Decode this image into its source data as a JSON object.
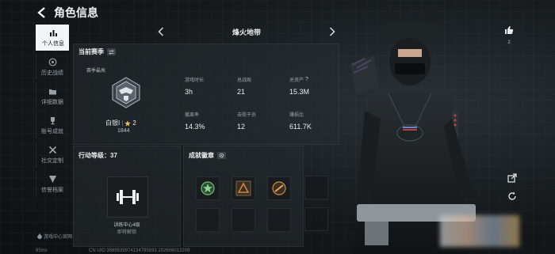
{
  "header": {
    "title": "角色信息"
  },
  "sidebar": {
    "items": [
      {
        "label": "个人信息",
        "icon": "bar-chart-icon",
        "active": true
      },
      {
        "label": "历史战绩",
        "icon": "history-icon"
      },
      {
        "label": "详细数据",
        "icon": "folder-icon"
      },
      {
        "label": "账号成就",
        "icon": "trophy-icon"
      },
      {
        "label": "社交定制",
        "icon": "tools-icon"
      },
      {
        "label": "信誉档案",
        "icon": "shield-icon"
      }
    ],
    "footer": "游戏中心官网"
  },
  "season_nav": {
    "name": "烽火地带"
  },
  "current_season": {
    "title": "当前赛季",
    "best_label": "赛季最高",
    "rank_name": "白银I",
    "rank_stars": "2",
    "rank_score": "1844",
    "stats": [
      {
        "label": "游戏时长",
        "value": "3h"
      },
      {
        "label": "总战局",
        "value": "21"
      },
      {
        "label": "总资产",
        "value": "15.3M",
        "has_help": true
      },
      {
        "label": "撤离率",
        "value": "14.3%"
      },
      {
        "label": "击败干员",
        "value": "12"
      },
      {
        "label": "赚损比",
        "value": "611.7K"
      }
    ]
  },
  "action_level": {
    "title": "行动等级：37",
    "facility": "训练中心4级",
    "unlock": "即将解锁"
  },
  "achievements": {
    "title": "成就徽章"
  },
  "like": {
    "count": "2"
  },
  "footer": {
    "ping": "65ms",
    "uid": "CN UID:3589539974134795833 202606012209"
  },
  "colors": {
    "accent_white": "#f2f4f5",
    "panel_bg": "#262c30",
    "gold_star": "#e8c04a",
    "badge_green": "#6fbf73",
    "badge_orange": "#d08a3a"
  }
}
